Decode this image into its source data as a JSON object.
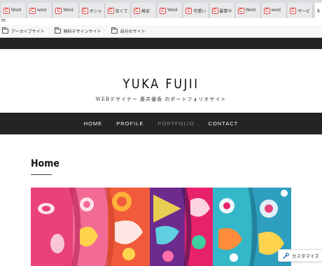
{
  "browser": {
    "tabs": [
      {
        "label": "Word"
      },
      {
        "label": "word"
      },
      {
        "label": "Word"
      },
      {
        "label": "オシャ"
      },
      {
        "label": "安くて"
      },
      {
        "label": "格安"
      },
      {
        "label": "Word"
      },
      {
        "label": "可愛い"
      },
      {
        "label": "副業や"
      },
      {
        "label": "Word"
      },
      {
        "label": "word"
      },
      {
        "label": "サービ"
      }
    ],
    "address_fragment": "m",
    "bookmarks": [
      {
        "label": "アーカイブサイト"
      },
      {
        "label": "無料デザインサイト"
      },
      {
        "label": "自分のサイト"
      }
    ]
  },
  "site": {
    "title": "YUKA FUJII",
    "tagline": "WEBデザイナー 藤井優香 のポートフォリオサイト",
    "nav": [
      {
        "label": "HOME",
        "current": false
      },
      {
        "label": "PROFILE",
        "current": false
      },
      {
        "label": "PORTFOLIO",
        "current": true
      },
      {
        "label": "CONTACT",
        "current": false
      }
    ],
    "page_title": "Home",
    "customize_label": "カスタマイズ"
  },
  "colors": {
    "dark_bar": "#222426",
    "nav_muted": "#8c8c8c",
    "favicon_red": "#e24b4b"
  }
}
